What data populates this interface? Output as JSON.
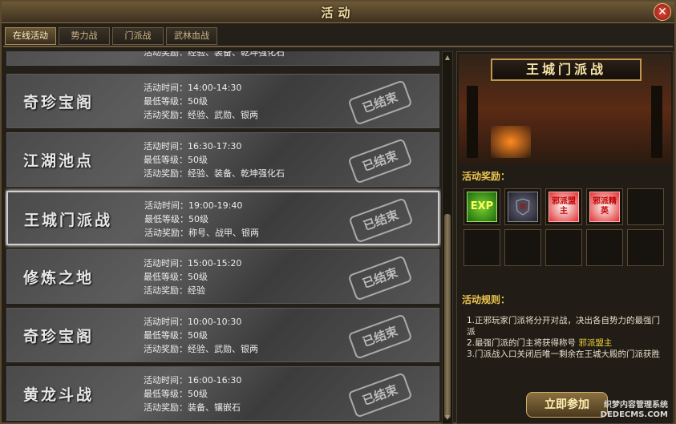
{
  "window": {
    "title": "活动",
    "close_label": "✕"
  },
  "tabs": [
    {
      "label": "在线活动",
      "active": true
    },
    {
      "label": "势力战"
    },
    {
      "label": "门派战"
    },
    {
      "label": "武林血战"
    }
  ],
  "activities": [
    {
      "name": "",
      "time": "",
      "level": "",
      "reward": "活动奖励：经验、装备、乾坤强化石",
      "status": ""
    },
    {
      "name": "奇珍宝阁",
      "time": "活动时间：14:00-14:30",
      "level": "最低等级：50级",
      "reward": "活动奖励：经验、武勋、银两",
      "status": "已结束"
    },
    {
      "name": "江湖池点",
      "time": "活动时间：16:30-17:30",
      "level": "最低等级：50级",
      "reward": "活动奖励：经验、装备、乾坤强化石",
      "status": "已结束"
    },
    {
      "name": "王城门派战",
      "time": "活动时间：19:00-19:40",
      "level": "最低等级：50级",
      "reward": "活动奖励：称号、战甲、银两",
      "status": "已结束"
    },
    {
      "name": "修炼之地",
      "time": "活动时间：15:00-15:20",
      "level": "最低等级：50级",
      "reward": "活动奖励：经验",
      "status": "已结束"
    },
    {
      "name": "奇珍宝阁",
      "time": "活动时间：10:00-10:30",
      "level": "最低等级：50级",
      "reward": "活动奖励：经验、武勋、银两",
      "status": "已结束"
    },
    {
      "name": "黄龙斗战",
      "time": "活动时间：16:00-16:30",
      "level": "最低等级：50级",
      "reward": "活动奖励：装备、镶嵌石",
      "status": "已结束"
    }
  ],
  "detail": {
    "banner_title": "王城门派战",
    "rewards_label": "活动奖励：",
    "reward_items": [
      {
        "label": "EXP",
        "icon": "exp-icon"
      },
      {
        "label": "",
        "icon": "armor-icon"
      },
      {
        "label": "邪派盟主",
        "icon": "title-icon"
      },
      {
        "label": "邪派精英",
        "icon": "title-icon"
      }
    ],
    "rules_label": "活动规则：",
    "rule1": "1.正邪玩家门派将分开对战，决出各自势力的最强门派",
    "rule2_prefix": "2.最强门派的门主将获得称号",
    "rule2_highlight": "邪派盟主",
    "rule3": "3.门派战入口关闭后唯一剩余在王城大殿的门派获胜",
    "join_label": "立即参加"
  },
  "watermark": {
    "line1": "织梦内容管理系统",
    "line2": "DEDECMS.COM"
  },
  "colors": {
    "accent": "#f0c850",
    "highlight": "#f0d040",
    "title": "#f3dca0"
  }
}
